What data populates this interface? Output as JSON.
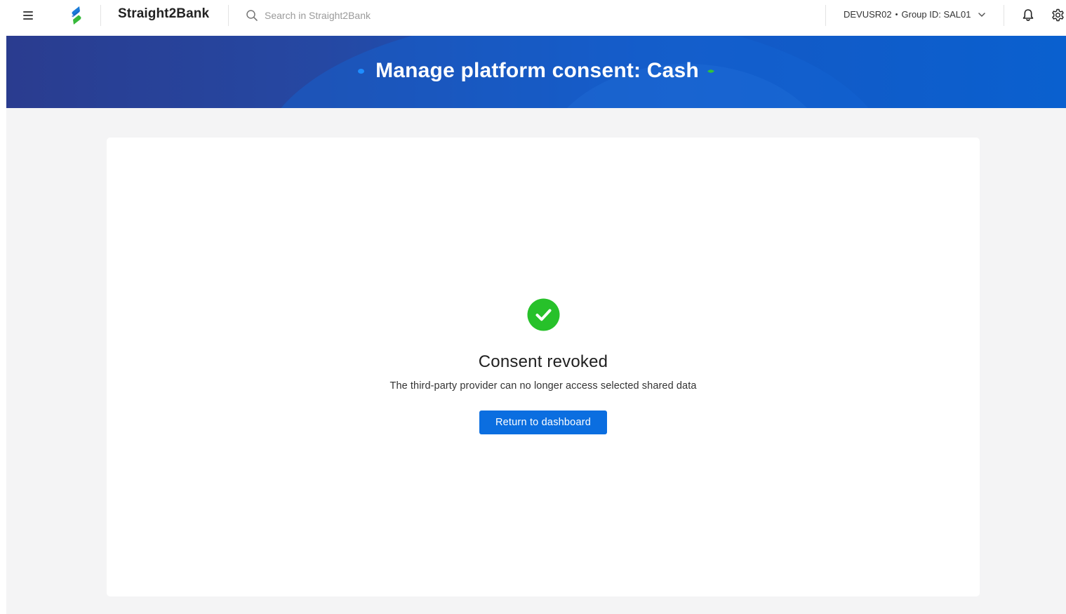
{
  "header": {
    "brand": "Straight2Bank",
    "search_placeholder": "Search in Straight2Bank",
    "user": {
      "username": "DEVUSR02",
      "separator": "•",
      "group": "Group ID: SAL01"
    },
    "icons": [
      "menu-icon",
      "sc-logo-icon",
      "search-icon",
      "chevron-down-icon",
      "bell-icon",
      "gear-icon"
    ]
  },
  "banner": {
    "title": "Manage platform consent: Cash"
  },
  "result": {
    "icon": "check-circle-icon",
    "title": "Consent revoked",
    "description": "The third-party provider can no longer access selected shared data",
    "button_label": "Return to dashboard"
  },
  "colors": {
    "primary_button": "#0b6ee0",
    "success": "#27c12a",
    "banner_start": "#2a3c8f",
    "banner_end": "#0a60cf"
  }
}
